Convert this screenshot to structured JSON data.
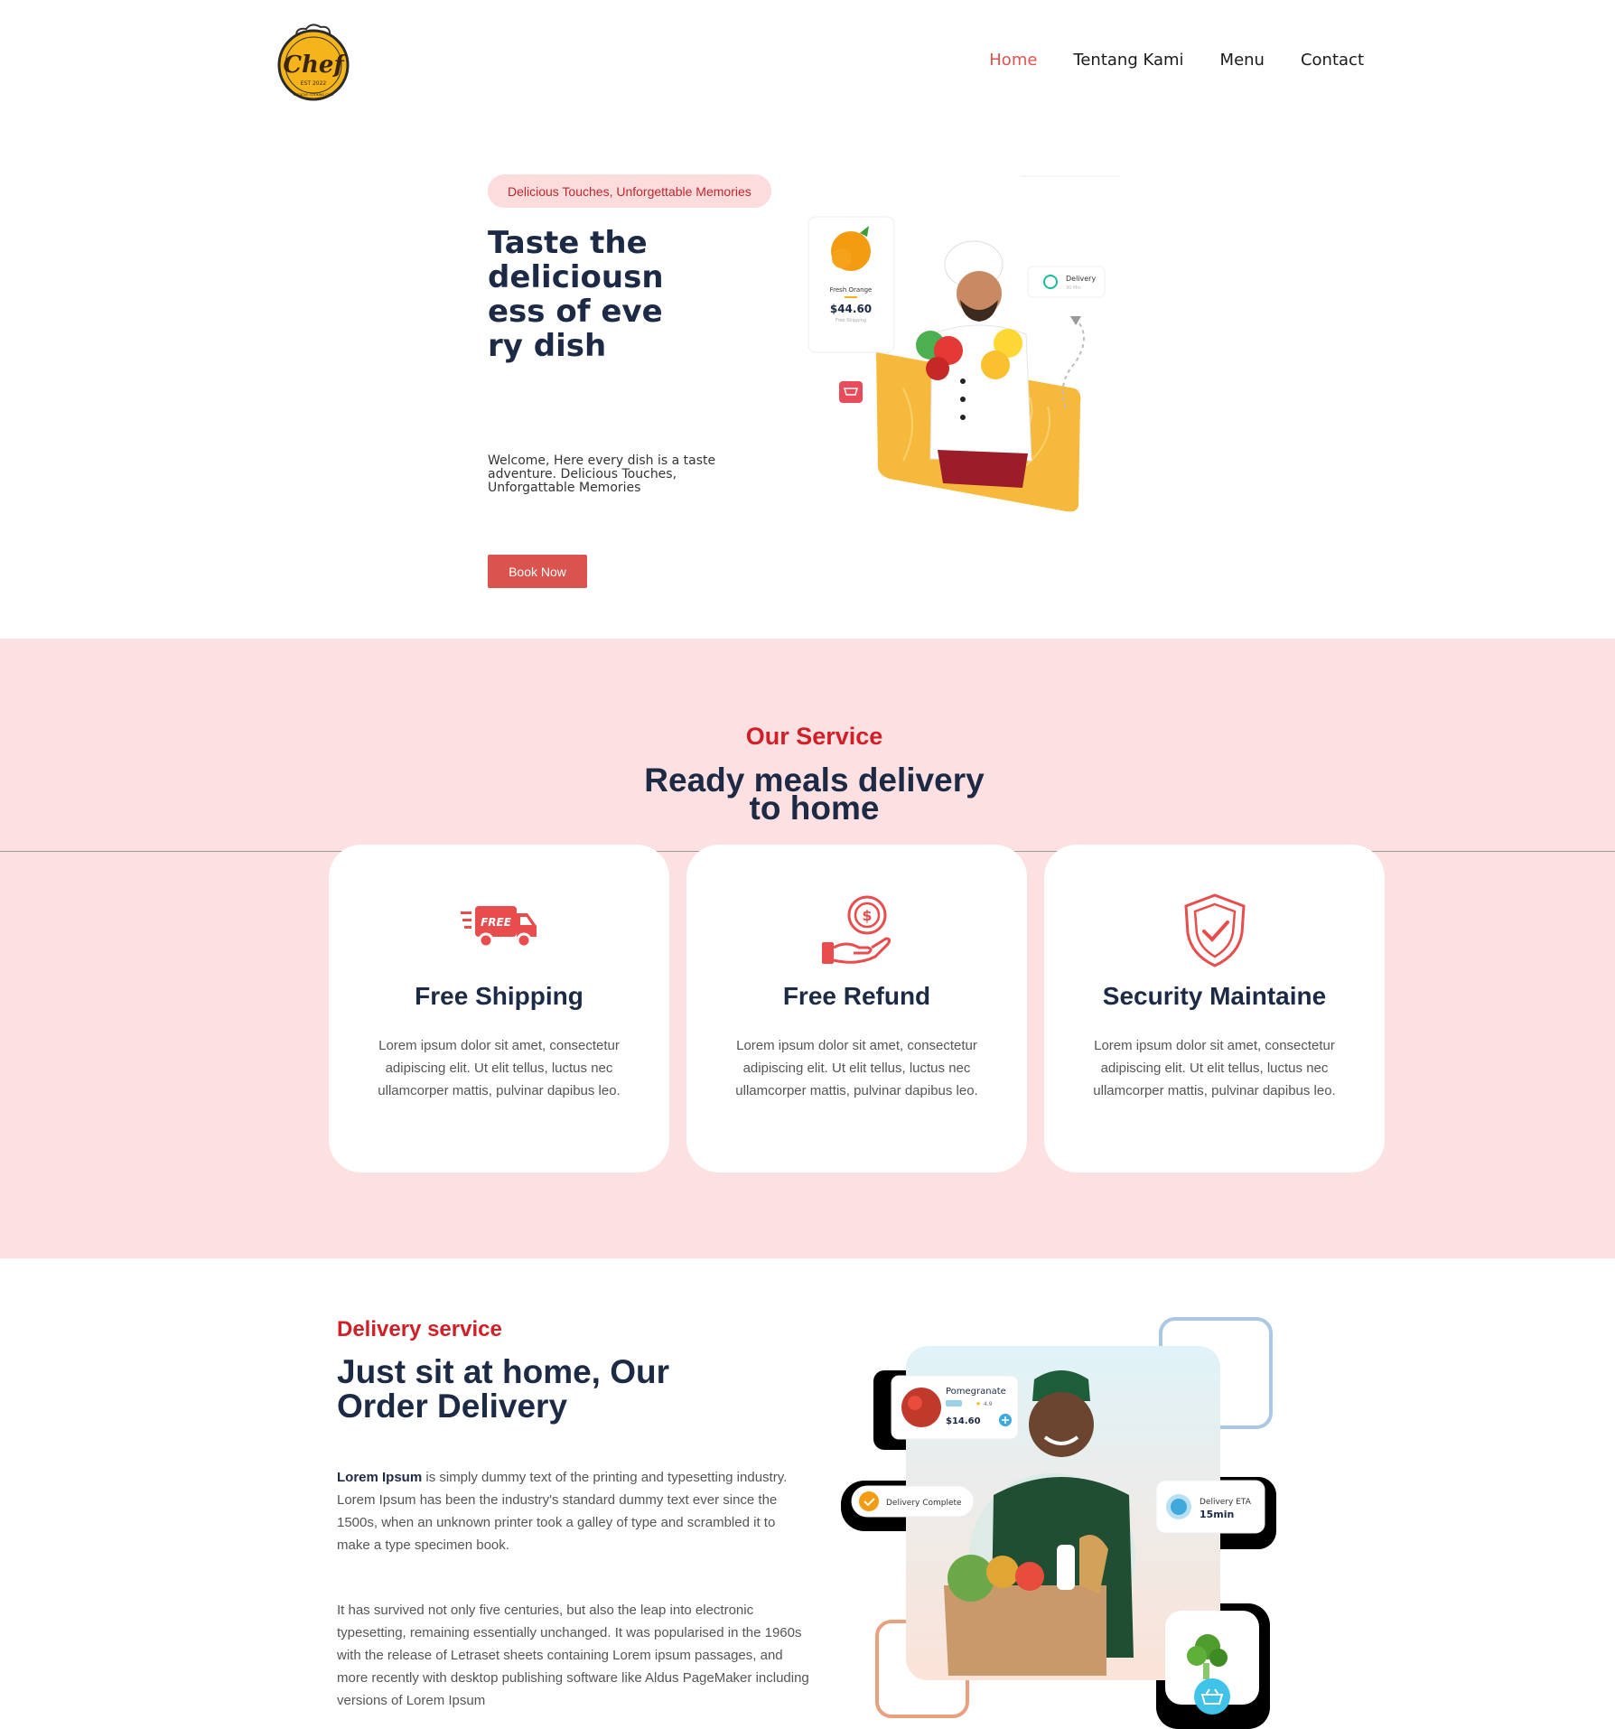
{
  "brand": {
    "logo_text": "Chef",
    "logo_sub": "EST 2022",
    "logo_tagline": "CREATIVE COOKING CAFE"
  },
  "nav": {
    "items": [
      {
        "label": "Home",
        "active": true
      },
      {
        "label": "Tentang Kami",
        "active": false
      },
      {
        "label": "Menu",
        "active": false
      },
      {
        "label": "Contact",
        "active": false
      }
    ]
  },
  "hero": {
    "badge": "Delicious Touches, Unforgettable Memories",
    "title": "Taste the deliciousness of every dish",
    "subtitle": "Welcome, Here every dish is a taste adventure. Delicious Touches, Unforgattable Memories",
    "button": "Book Now",
    "product_card": {
      "name": "Fresh Orange",
      "price": "$44.60",
      "note": "Free Shipping"
    },
    "delivery_card": {
      "label": "Delivery",
      "time": "30 Min"
    }
  },
  "service": {
    "eyebrow": "Our Service",
    "title_line1": "Ready meals delivery",
    "title_line2": "to home",
    "cards": [
      {
        "icon": "free-shipping-truck-icon",
        "icon_text": "FREE",
        "title": "Free Shipping",
        "text": "Lorem ipsum dolor sit amet, consectetur adipiscing elit. Ut elit tellus, luctus nec ullamcorper mattis, pulvinar dapibus leo."
      },
      {
        "icon": "refund-hand-coin-icon",
        "title": "Free Refund",
        "text": "Lorem ipsum dolor sit amet, consectetur adipiscing elit. Ut elit tellus, luctus nec ullamcorper mattis, pulvinar dapibus leo."
      },
      {
        "icon": "shield-check-icon",
        "title": "Security Maintaine",
        "text": "Lorem ipsum dolor sit amet, consectetur adipiscing elit. Ut elit tellus, luctus nec ullamcorper mattis, pulvinar dapibus leo."
      }
    ]
  },
  "delivery": {
    "eyebrow": "Delivery service",
    "title": "Just sit at home, Our Order Delivery",
    "p1_bold": "Lorem Ipsum",
    "p1_rest": " is simply dummy text of the printing and typesetting industry. Lorem Ipsum has been the industry's standard dummy text ever since the 1500s, when an unknown printer took a galley of type and scrambled it to make a type specimen book.",
    "p2": "It has survived not only five centuries, but also the leap into electronic typesetting, remaining essentially unchanged. It was popularised in the 1960s with the release of Letraset sheets containing Lorem ipsum passages, and more recently with desktop publishing software like Aldus PageMaker including versions of Lorem Ipsum",
    "product_card": {
      "name": "Pomegranate",
      "price": "$14.60",
      "rating": "4.9"
    },
    "status_card": "Delivery Complete",
    "eta_card": {
      "label": "Delivery ETA",
      "value": "15min"
    }
  },
  "colors": {
    "accent": "#d9534f",
    "accent_dark": "#d11f27",
    "heading": "#1d2a45",
    "service_bg": "#fde0e1",
    "badge_bg": "#fcdcdc"
  }
}
